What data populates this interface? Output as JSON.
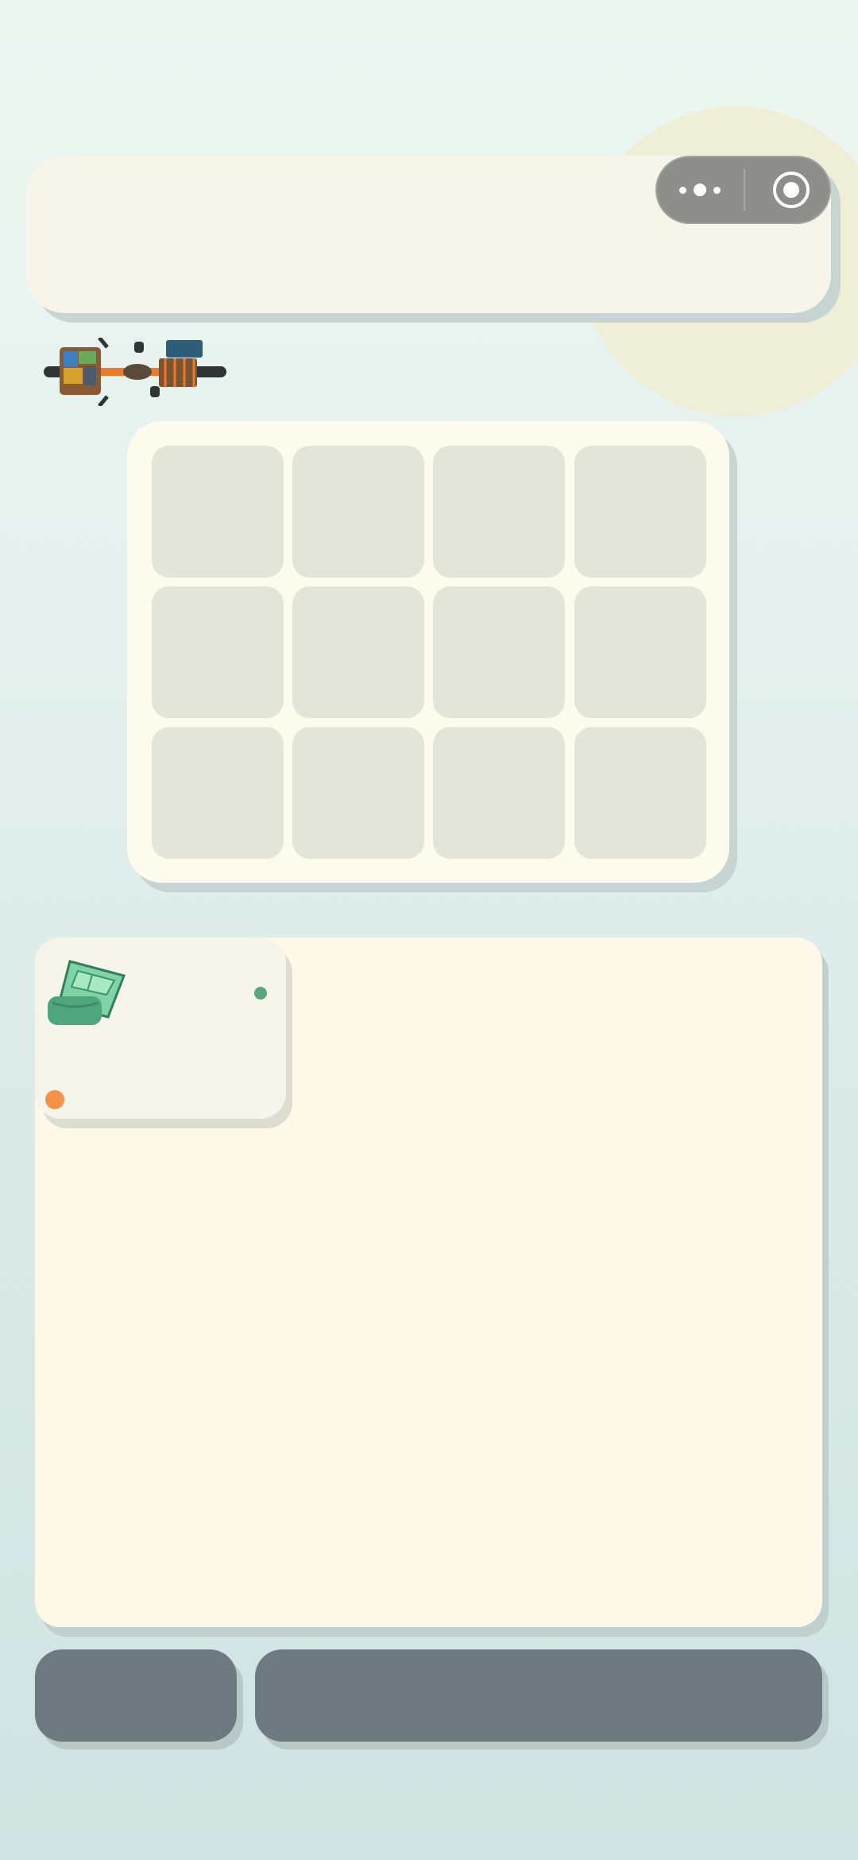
{
  "capsule": {
    "more_icon": "more-dots-icon",
    "close_icon": "target-circle-icon"
  },
  "vehicle": {
    "icon": "cargo-bicycle-icon"
  },
  "board": {
    "rows": 3,
    "columns": 4,
    "filled_cells": 0
  },
  "inventory": {
    "items": [
      {
        "icon": "green-blanket-icon",
        "indicator_colors": [
          "#56a57b",
          "#f5914a"
        ]
      }
    ]
  },
  "actions": {
    "left_label": "",
    "right_label": ""
  },
  "colors": {
    "panel": "#f7f5ea",
    "board": "#fdfbee",
    "cell": "#e2e5d8",
    "tray": "#fdf8e8",
    "button": "#6e7a80"
  }
}
